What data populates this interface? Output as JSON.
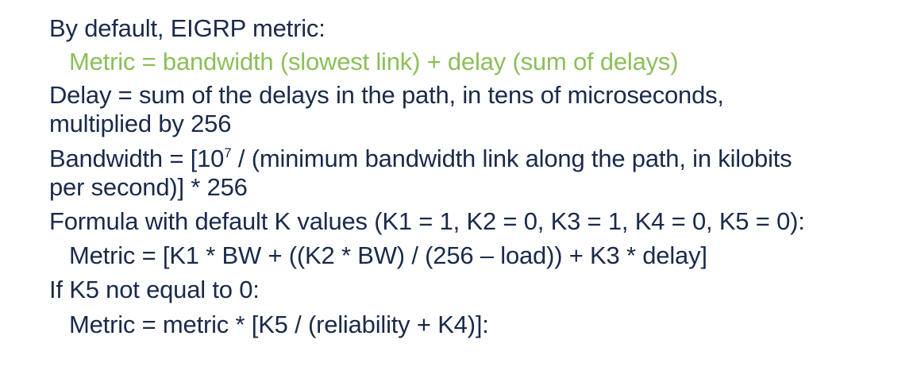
{
  "lines": {
    "l1": "By default, EIGRP metric:",
    "l2": "Metric = bandwidth (slowest link) + delay (sum of delays)",
    "l3": "Delay = sum of the delays in the path, in tens of microseconds,",
    "l4": "multiplied by 256",
    "l5_pre": "Bandwidth = [10",
    "l5_sup": "7",
    "l5_post": " / (minimum bandwidth link along the path, in kilobits",
    "l6": "per second)] * 256",
    "l7": "Formula with default K values (K1 = 1, K2 = 0, K3 = 1, K4 = 0, K5 = 0):",
    "l8": "Metric = [K1 * BW + ((K2 * BW) / (256 – load)) + K3 * delay]",
    "l9": "If K5 not equal to 0:",
    "l10": "Metric = metric * [K5 / (reliability + K4)]:"
  },
  "colors": {
    "text": "#1a2a4a",
    "highlight": "#8cbf5a",
    "background": "#ffffff"
  }
}
